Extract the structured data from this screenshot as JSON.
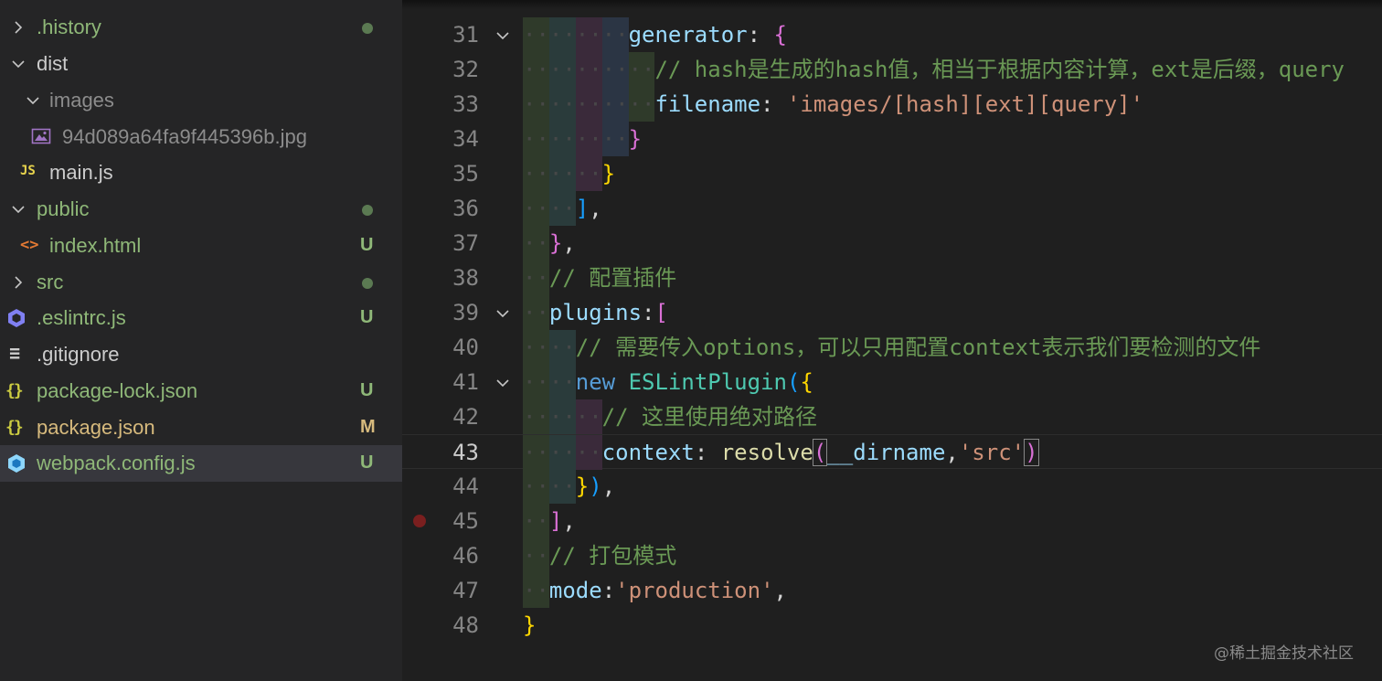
{
  "explorer": {
    "items": [
      {
        "name": ".history",
        "chevron": "right",
        "color": "#8fb878",
        "status": "dot",
        "badge": ""
      },
      {
        "name": "dist",
        "chevron": "down",
        "color": "#cccccc",
        "status": "",
        "badge": ""
      },
      {
        "name": "images",
        "chevron": "down",
        "color": "#8c8c8c",
        "status": "",
        "badge": ""
      },
      {
        "name": "94d089a64fa9f445396b.jpg",
        "chevron": "",
        "icon": "image-file-icon",
        "color": "#8c8c8c",
        "status": "",
        "badge": ""
      },
      {
        "name": "main.js",
        "chevron": "",
        "icon": "js-file-icon",
        "icon_text": "JS",
        "color": "#cccccc",
        "status": "",
        "badge": ""
      },
      {
        "name": "public",
        "chevron": "down",
        "color": "#8fb878",
        "status": "dot",
        "badge": ""
      },
      {
        "name": "index.html",
        "chevron": "",
        "icon": "html-file-icon",
        "icon_text": "<>",
        "color": "#8fb878",
        "status": "",
        "badge": "U"
      },
      {
        "name": "src",
        "chevron": "right",
        "color": "#8fb878",
        "status": "dot",
        "badge": ""
      },
      {
        "name": ".eslintrc.js",
        "chevron": "",
        "icon": "eslint-file-icon",
        "color": "#8fb878",
        "status": "",
        "badge": "U"
      },
      {
        "name": ".gitignore",
        "chevron": "",
        "icon": "gitignore-file-icon",
        "icon_text": "≡",
        "color": "#cccccc",
        "status": "",
        "badge": ""
      },
      {
        "name": "package-lock.json",
        "chevron": "",
        "icon": "json-file-icon",
        "icon_text": "{}",
        "color": "#8fb878",
        "status": "",
        "badge": "U"
      },
      {
        "name": "package.json",
        "chevron": "",
        "icon": "json-file-icon",
        "icon_text": "{}",
        "color": "#d7ba7d",
        "status": "",
        "badge": "M"
      },
      {
        "name": "webpack.config.js",
        "chevron": "",
        "icon": "webpack-file-icon",
        "color": "#8fb878",
        "status": "",
        "badge": "U",
        "selected": true
      }
    ]
  },
  "editor": {
    "current_line": "43",
    "lines": [
      {
        "num": "31",
        "fold": true,
        "tokens": [
          [
            "tok-key",
            "generator"
          ],
          [
            "tok-punc",
            ": "
          ],
          [
            "b-p",
            "{"
          ]
        ]
      },
      {
        "num": "32",
        "tokens": [
          [
            "tok-com",
            "// hash是生成的hash值，相当于根据内容计算，ext是后缀，query"
          ]
        ]
      },
      {
        "num": "33",
        "tokens": [
          [
            "tok-key",
            "filename"
          ],
          [
            "tok-punc",
            ": "
          ],
          [
            "tok-str",
            "'images/[hash][ext][query]'"
          ]
        ]
      },
      {
        "num": "34",
        "tokens": [
          [
            "b-p",
            "}"
          ]
        ]
      },
      {
        "num": "35",
        "tokens": [
          [
            "b-y",
            "}"
          ]
        ]
      },
      {
        "num": "36",
        "tokens": [
          [
            "b-b",
            "]"
          ],
          [
            "tok-punc",
            ","
          ]
        ]
      },
      {
        "num": "37",
        "tokens": [
          [
            "b-p",
            "}"
          ],
          [
            "tok-punc",
            ","
          ]
        ]
      },
      {
        "num": "38",
        "tokens": [
          [
            "tok-com",
            "// 配置插件"
          ]
        ]
      },
      {
        "num": "39",
        "fold": true,
        "tokens": [
          [
            "tok-key",
            "plugins"
          ],
          [
            "tok-punc",
            ":"
          ],
          [
            "b-p",
            "["
          ]
        ]
      },
      {
        "num": "40",
        "tokens": [
          [
            "tok-com",
            "// 需要传入options，可以只用配置context表示我们要检测的文件"
          ]
        ]
      },
      {
        "num": "41",
        "fold": true,
        "tokens": [
          [
            "tok-kw",
            "new "
          ],
          [
            "tok-cls",
            "ESLintPlugin"
          ],
          [
            "b-b",
            "("
          ],
          [
            "b-y",
            "{"
          ]
        ]
      },
      {
        "num": "42",
        "tokens": [
          [
            "tok-com",
            "// 这里使用绝对路径"
          ]
        ]
      },
      {
        "num": "43",
        "tokens": [
          [
            "tok-key",
            "context"
          ],
          [
            "tok-punc",
            ": "
          ],
          [
            "tok-fn",
            "resolve"
          ],
          [
            "b-p",
            "("
          ],
          [
            "tok-key",
            "__dirname"
          ],
          [
            "tok-punc",
            ","
          ],
          [
            "tok-str",
            "'src'"
          ],
          [
            "b-p",
            ")"
          ]
        ]
      },
      {
        "num": "44",
        "tokens": [
          [
            "b-y",
            "}"
          ],
          [
            "b-b",
            ")"
          ],
          [
            "tok-punc",
            ","
          ]
        ]
      },
      {
        "num": "45",
        "breakpoint": true,
        "tokens": [
          [
            "b-p",
            "]"
          ],
          [
            "tok-punc",
            ","
          ]
        ]
      },
      {
        "num": "46",
        "tokens": [
          [
            "tok-com",
            "// 打包模式"
          ]
        ]
      },
      {
        "num": "47",
        "tokens": [
          [
            "tok-key",
            "mode"
          ],
          [
            "tok-punc",
            ":"
          ],
          [
            "tok-str",
            "'production'"
          ],
          [
            "tok-punc",
            ","
          ]
        ]
      },
      {
        "num": "48",
        "tokens": [
          [
            "b-y",
            "}"
          ]
        ]
      }
    ]
  },
  "watermark": "@稀土掘金技术社区"
}
